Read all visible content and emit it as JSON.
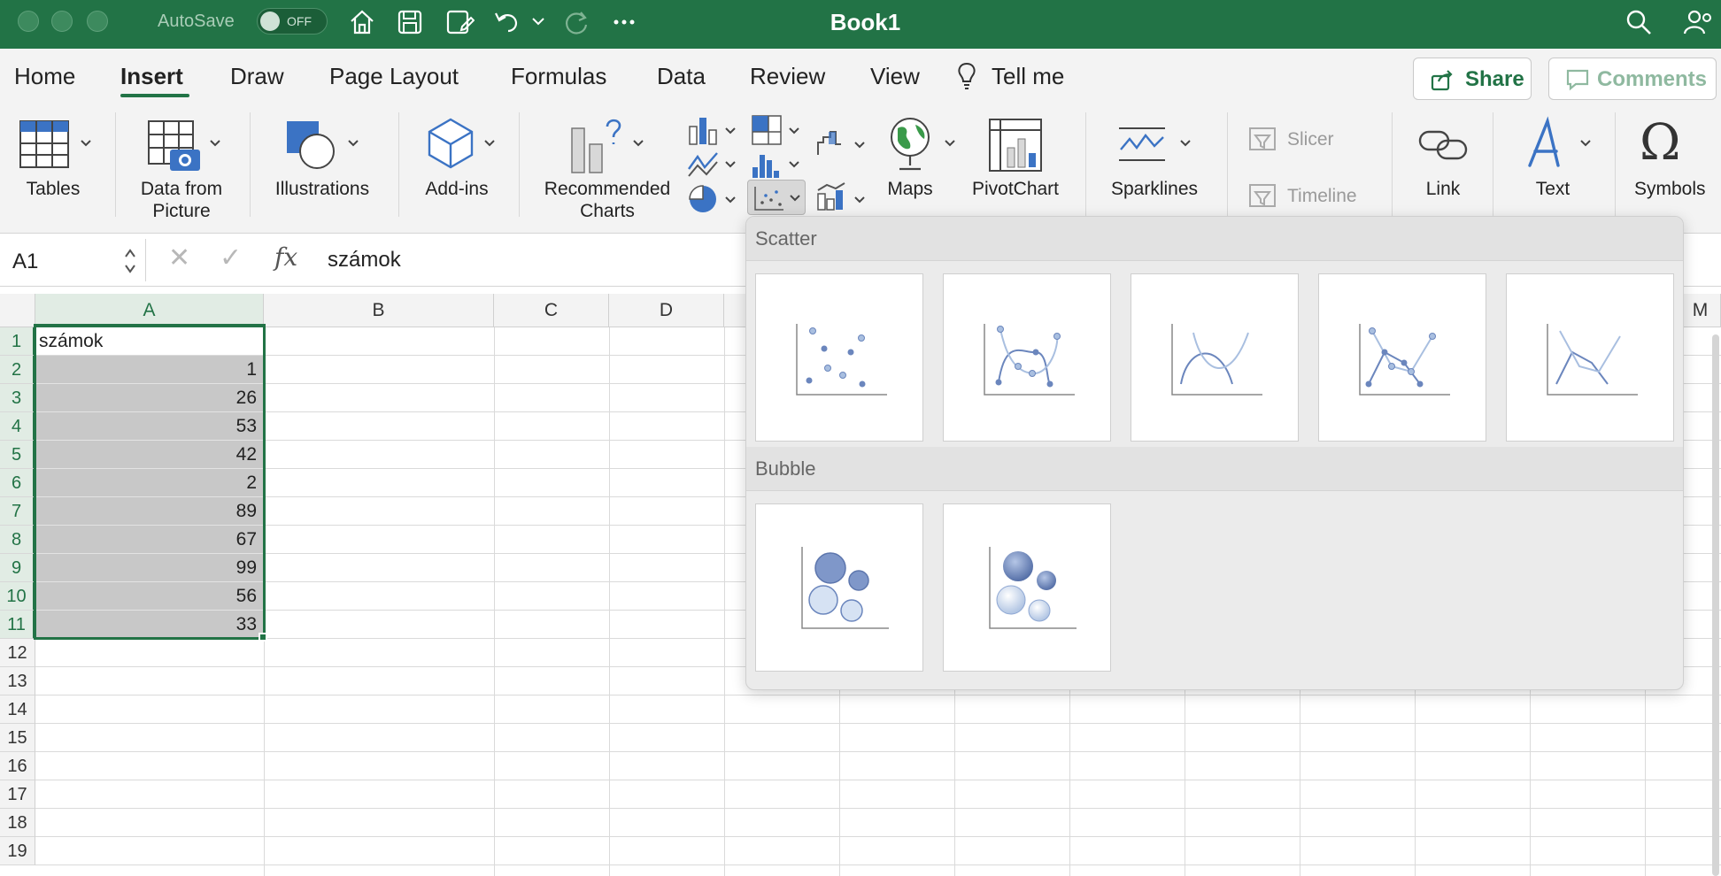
{
  "title_bar": {
    "autosave_label": "AutoSave",
    "autosave_state": "OFF",
    "document_title": "Book1"
  },
  "tabs": [
    {
      "label": "Home"
    },
    {
      "label": "Insert",
      "active": true
    },
    {
      "label": "Draw"
    },
    {
      "label": "Page Layout"
    },
    {
      "label": "Formulas"
    },
    {
      "label": "Data"
    },
    {
      "label": "Review"
    },
    {
      "label": "View"
    },
    {
      "label": "Tell me"
    }
  ],
  "header_buttons": {
    "share": "Share",
    "comments": "Comments"
  },
  "ribbon": {
    "tables": "Tables",
    "data_from_picture_1": "Data from",
    "data_from_picture_2": "Picture",
    "illustrations": "Illustrations",
    "addins": "Add-ins",
    "recommended_charts_1": "Recommended",
    "recommended_charts_2": "Charts",
    "maps": "Maps",
    "pivotchart": "PivotChart",
    "sparklines": "Sparklines",
    "slicer": "Slicer",
    "timeline": "Timeline",
    "link": "Link",
    "text": "Text",
    "symbols": "Symbols"
  },
  "formula_bar": {
    "name_box": "A1",
    "fx": "fx",
    "value": "számok"
  },
  "columns": [
    "A",
    "B",
    "C",
    "D",
    "M"
  ],
  "rows": [
    "1",
    "2",
    "3",
    "4",
    "5",
    "6",
    "7",
    "8",
    "9",
    "10",
    "11",
    "12",
    "13",
    "14",
    "15",
    "16",
    "17",
    "18",
    "19"
  ],
  "cells": {
    "header": "számok",
    "values": [
      "1",
      "26",
      "53",
      "42",
      "2",
      "89",
      "67",
      "99",
      "56",
      "33"
    ]
  },
  "chart_dropdown": {
    "scatter_label": "Scatter",
    "bubble_label": "Bubble",
    "accent_color": "#6b86bd",
    "light_color": "#a9bfe0"
  }
}
